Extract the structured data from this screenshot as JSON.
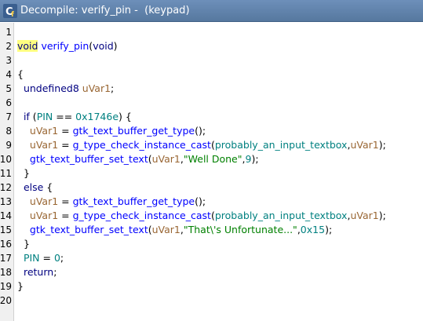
{
  "window": {
    "title": "Decompile: verify_pin -  (keypad)",
    "icon": "decompiler-icon"
  },
  "lines": [
    {
      "n": "1",
      "t": []
    },
    {
      "n": "2",
      "t": [
        {
          "k": "kw-hl",
          "v": "void"
        },
        {
          "k": "",
          "v": " "
        },
        {
          "k": "fn",
          "v": "verify_pin"
        },
        {
          "k": "",
          "v": "("
        },
        {
          "k": "kw",
          "v": "void"
        },
        {
          "k": "",
          "v": ")"
        }
      ]
    },
    {
      "n": "3",
      "t": []
    },
    {
      "n": "4",
      "t": [
        {
          "k": "",
          "v": "{"
        }
      ]
    },
    {
      "n": "5",
      "t": [
        {
          "k": "",
          "v": "  "
        },
        {
          "k": "type",
          "v": "undefined8"
        },
        {
          "k": "",
          "v": " "
        },
        {
          "k": "var",
          "v": "uVar1"
        },
        {
          "k": "",
          "v": ";"
        }
      ]
    },
    {
      "n": "6",
      "t": []
    },
    {
      "n": "7",
      "t": [
        {
          "k": "",
          "v": "  "
        },
        {
          "k": "kw",
          "v": "if"
        },
        {
          "k": "",
          "v": " ("
        },
        {
          "k": "glob",
          "v": "PIN"
        },
        {
          "k": "",
          "v": " == "
        },
        {
          "k": "num-c",
          "v": "0x1746e"
        },
        {
          "k": "",
          "v": ") {"
        }
      ]
    },
    {
      "n": "8",
      "t": [
        {
          "k": "",
          "v": "    "
        },
        {
          "k": "var",
          "v": "uVar1"
        },
        {
          "k": "",
          "v": " = "
        },
        {
          "k": "fn",
          "v": "gtk_text_buffer_get_type"
        },
        {
          "k": "",
          "v": "();"
        }
      ]
    },
    {
      "n": "9",
      "t": [
        {
          "k": "",
          "v": "    "
        },
        {
          "k": "var",
          "v": "uVar1"
        },
        {
          "k": "",
          "v": " = "
        },
        {
          "k": "fn",
          "v": "g_type_check_instance_cast"
        },
        {
          "k": "",
          "v": "("
        },
        {
          "k": "glob",
          "v": "probably_an_input_textbox"
        },
        {
          "k": "",
          "v": ","
        },
        {
          "k": "var",
          "v": "uVar1"
        },
        {
          "k": "",
          "v": ");"
        }
      ]
    },
    {
      "n": "10",
      "t": [
        {
          "k": "",
          "v": "    "
        },
        {
          "k": "fn",
          "v": "gtk_text_buffer_set_text"
        },
        {
          "k": "",
          "v": "("
        },
        {
          "k": "var",
          "v": "uVar1"
        },
        {
          "k": "",
          "v": ","
        },
        {
          "k": "str",
          "v": "\"Well Done\""
        },
        {
          "k": "",
          "v": ","
        },
        {
          "k": "num-c",
          "v": "9"
        },
        {
          "k": "",
          "v": ");"
        }
      ]
    },
    {
      "n": "11",
      "t": [
        {
          "k": "",
          "v": "  }"
        }
      ]
    },
    {
      "n": "12",
      "t": [
        {
          "k": "",
          "v": "  "
        },
        {
          "k": "kw",
          "v": "else"
        },
        {
          "k": "",
          "v": " {"
        }
      ]
    },
    {
      "n": "13",
      "t": [
        {
          "k": "",
          "v": "    "
        },
        {
          "k": "var",
          "v": "uVar1"
        },
        {
          "k": "",
          "v": " = "
        },
        {
          "k": "fn",
          "v": "gtk_text_buffer_get_type"
        },
        {
          "k": "",
          "v": "();"
        }
      ]
    },
    {
      "n": "14",
      "t": [
        {
          "k": "",
          "v": "    "
        },
        {
          "k": "var",
          "v": "uVar1"
        },
        {
          "k": "",
          "v": " = "
        },
        {
          "k": "fn",
          "v": "g_type_check_instance_cast"
        },
        {
          "k": "",
          "v": "("
        },
        {
          "k": "glob",
          "v": "probably_an_input_textbox"
        },
        {
          "k": "",
          "v": ","
        },
        {
          "k": "var",
          "v": "uVar1"
        },
        {
          "k": "",
          "v": ");"
        }
      ]
    },
    {
      "n": "15",
      "t": [
        {
          "k": "",
          "v": "    "
        },
        {
          "k": "fn",
          "v": "gtk_text_buffer_set_text"
        },
        {
          "k": "",
          "v": "("
        },
        {
          "k": "var",
          "v": "uVar1"
        },
        {
          "k": "",
          "v": ","
        },
        {
          "k": "str",
          "v": "\"That\\'s Unfortunate...\""
        },
        {
          "k": "",
          "v": ","
        },
        {
          "k": "num-c",
          "v": "0x15"
        },
        {
          "k": "",
          "v": ");"
        }
      ]
    },
    {
      "n": "16",
      "t": [
        {
          "k": "",
          "v": "  }"
        }
      ]
    },
    {
      "n": "17",
      "t": [
        {
          "k": "",
          "v": "  "
        },
        {
          "k": "glob",
          "v": "PIN"
        },
        {
          "k": "",
          "v": " = "
        },
        {
          "k": "num-c",
          "v": "0"
        },
        {
          "k": "",
          "v": ";"
        }
      ]
    },
    {
      "n": "18",
      "t": [
        {
          "k": "",
          "v": "  "
        },
        {
          "k": "kw",
          "v": "return"
        },
        {
          "k": "",
          "v": ";"
        }
      ]
    },
    {
      "n": "19",
      "t": [
        {
          "k": "",
          "v": "}"
        }
      ]
    },
    {
      "n": "20",
      "t": []
    }
  ]
}
